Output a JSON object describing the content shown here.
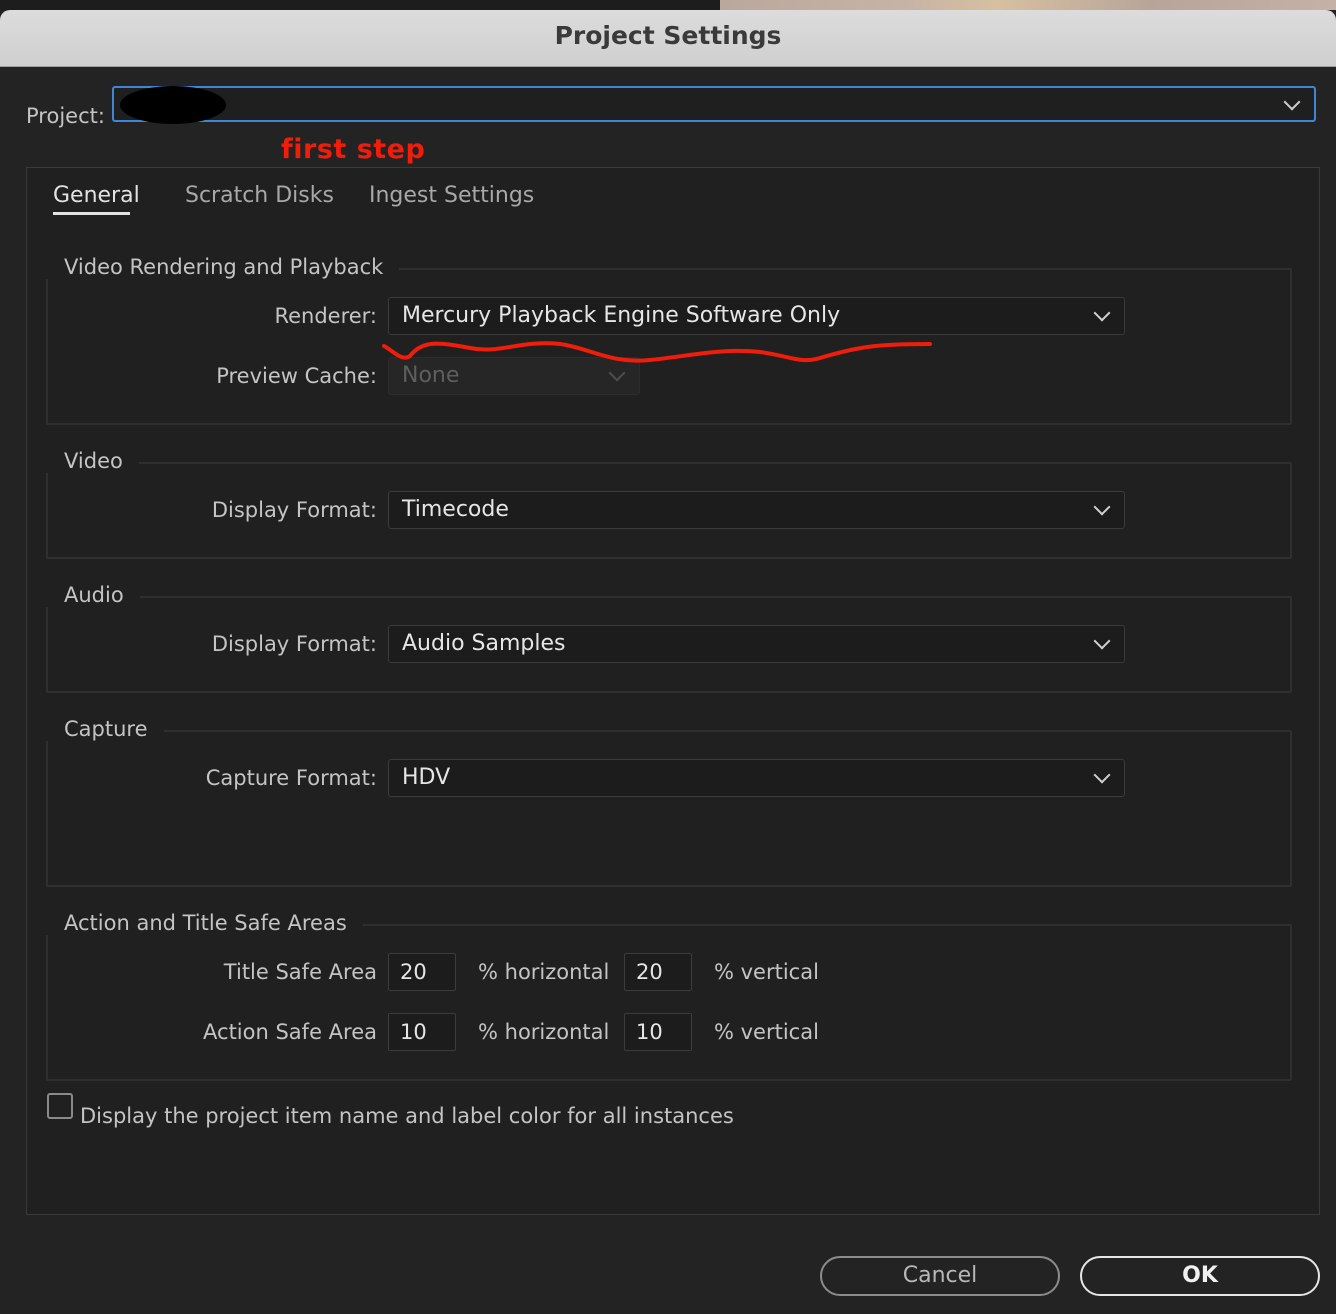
{
  "window": {
    "title": "Project Settings"
  },
  "project": {
    "label": "Project:",
    "value": ""
  },
  "annotation": {
    "text": "first  step",
    "color": "#f01d0b"
  },
  "tabs": [
    {
      "label": "General",
      "active": true
    },
    {
      "label": "Scratch Disks",
      "active": false
    },
    {
      "label": "Ingest Settings",
      "active": false
    }
  ],
  "video_rendering": {
    "title": "Video Rendering and Playback",
    "renderer_label": "Renderer:",
    "renderer_value": "Mercury Playback Engine Software Only",
    "preview_cache_label": "Preview Cache:",
    "preview_cache_value": "None"
  },
  "video": {
    "title": "Video",
    "display_format_label": "Display Format:",
    "display_format_value": "Timecode"
  },
  "audio": {
    "title": "Audio",
    "display_format_label": "Display Format:",
    "display_format_value": "Audio Samples"
  },
  "capture": {
    "title": "Capture",
    "capture_format_label": "Capture Format:",
    "capture_format_value": "HDV"
  },
  "safe_areas": {
    "title": "Action and Title Safe Areas",
    "title_safe_label": "Title Safe Area",
    "title_safe_h": "20",
    "title_safe_v": "20",
    "action_safe_label": "Action Safe Area",
    "action_safe_h": "10",
    "action_safe_v": "10",
    "horizontal_label": "% horizontal",
    "vertical_label": "% vertical"
  },
  "checkbox": {
    "label": "Display the project item name and label color for all instances",
    "checked": false
  },
  "buttons": {
    "cancel": "Cancel",
    "ok": "OK"
  },
  "colors": {
    "focus_blue": "#3f87d6",
    "annotation_red": "#f01d0b",
    "dialog_bg": "#232323"
  }
}
